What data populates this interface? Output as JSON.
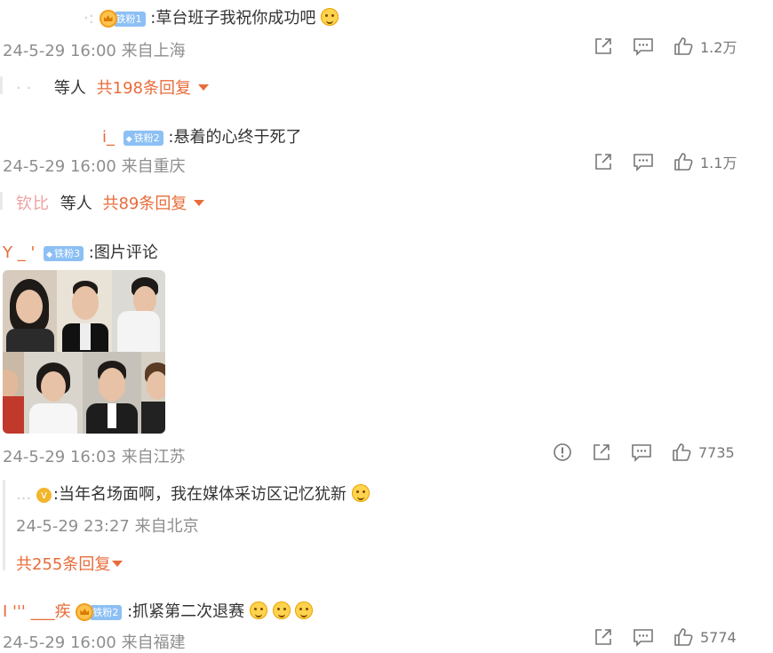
{
  "comments": [
    {
      "username": "·:",
      "badge": "铁粉1",
      "text": ":草台班子我祝你成功吧",
      "time": "24-5-29 16:00",
      "location": "来自上海",
      "likes": "1.2万",
      "reply_users": "· ·",
      "reply_suffix": "等人",
      "reply_count_label": "共198条回复"
    },
    {
      "username": "i_",
      "badge": "铁粉2",
      "text": ":悬着的心终于死了",
      "time": "24-5-29 16:00",
      "location": "来自重庆",
      "likes": "1.1万",
      "reply_users": "钦比",
      "reply_suffix": "等人",
      "reply_count_label": "共89条回复"
    },
    {
      "username": "Y   _ '",
      "badge": "铁粉3",
      "text": ":图片评论",
      "time": "24-5-29 16:03",
      "location": "来自江苏",
      "likes": "7735",
      "nested_reply": {
        "username": "...",
        "text": ":当年名场面啊，我在媒体采访区记忆犹新",
        "time": "24-5-29 23:27",
        "location": "来自北京",
        "reply_count_label": "共255条回复"
      }
    },
    {
      "username": "I    ''' ___疾",
      "badge": "铁粉2",
      "text": ":抓紧第二次退赛",
      "time": "24-5-29 16:00",
      "location": "来自福建",
      "likes": "5774"
    }
  ],
  "icons": {
    "share": "share-icon",
    "comment": "comment-icon",
    "like": "thumbs-up-icon",
    "report": "report-icon",
    "emoji": "emoji-icon"
  },
  "colors": {
    "accent": "#e86c3a",
    "badge": "#8cc0f4",
    "meta": "#8e8e8e"
  }
}
